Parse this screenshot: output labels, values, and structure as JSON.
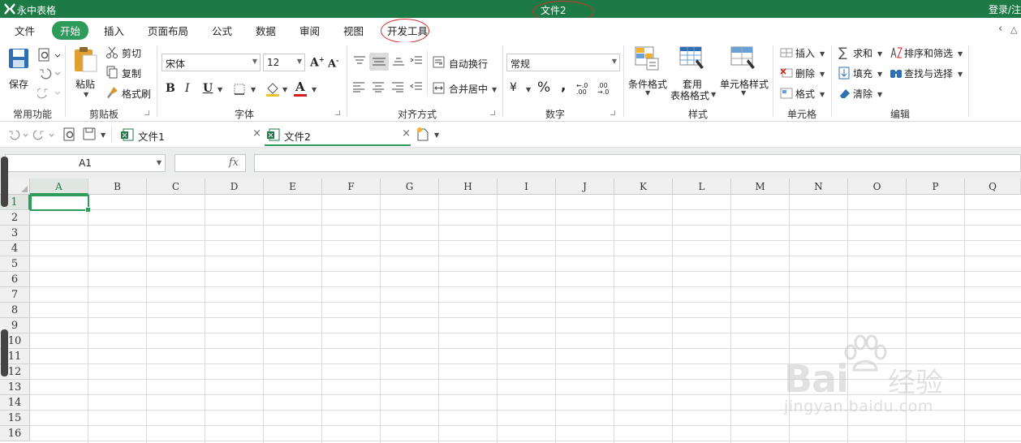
{
  "app": {
    "name": "永中表格",
    "document_title": "文件2",
    "login_label": "登录/注"
  },
  "menu": {
    "items": [
      "文件",
      "开始",
      "插入",
      "页面布局",
      "公式",
      "数据",
      "审阅",
      "视图",
      "开发工具"
    ],
    "active": "开始",
    "right_icons": [
      "chevron-left-icon",
      "collapse-ribbon-icon"
    ]
  },
  "ribbon": {
    "groups": {
      "common": {
        "label": "常用功能",
        "save": "保存"
      },
      "clipboard": {
        "label": "剪贴板",
        "paste": "粘贴",
        "cut": "剪切",
        "copy": "复制",
        "format_painter": "格式刷"
      },
      "font": {
        "label": "字体",
        "family": "宋体",
        "size": "12",
        "bold": "B",
        "italic": "I",
        "underline": "U",
        "font_color_letter": "A",
        "grow": "A",
        "shrink": "A"
      },
      "align": {
        "label": "对齐方式",
        "wrap": "自动换行",
        "merge": "合并居中"
      },
      "number": {
        "label": "数字",
        "format": "常规",
        "currency": "¥",
        "percent": "%",
        "comma": ",",
        "inc_decimal": "←.0 .00",
        "dec_decimal": ".00 →.0"
      },
      "styles": {
        "label": "样式",
        "conditional": "条件格式",
        "table_format_line1": "套用",
        "table_format_line2": "表格格式",
        "cell_styles": "单元格样式"
      },
      "cells": {
        "label": "单元格",
        "insert": "插入",
        "delete": "删除",
        "format": "格式"
      },
      "editing": {
        "label": "编辑",
        "sum": "求和",
        "fill": "填充",
        "clear": "清除",
        "sort": "排序和筛选",
        "find": "查找与选择"
      }
    },
    "colors": {
      "accent": "#2e9b5b",
      "titlebar": "#1d7a45",
      "highlight_oval": "#d03030"
    }
  },
  "doc_tabs": [
    {
      "label": "文件1",
      "active": false
    },
    {
      "label": "文件2",
      "active": true
    }
  ],
  "formula_bar": {
    "name_box": "A1",
    "fx_label": "fx",
    "formula": ""
  },
  "grid": {
    "columns": [
      "A",
      "B",
      "C",
      "D",
      "E",
      "F",
      "G",
      "H",
      "I",
      "J",
      "K",
      "L",
      "M",
      "N",
      "O",
      "P",
      "Q"
    ],
    "rows": [
      "1",
      "2",
      "3",
      "4",
      "5",
      "6",
      "7",
      "8",
      "9",
      "10",
      "11",
      "12",
      "13",
      "14",
      "15",
      "16"
    ],
    "active_cell": "A1"
  },
  "watermark": {
    "brand": "Bai",
    "brand_cn": "经验",
    "url": "jingyan.baidu.com"
  }
}
